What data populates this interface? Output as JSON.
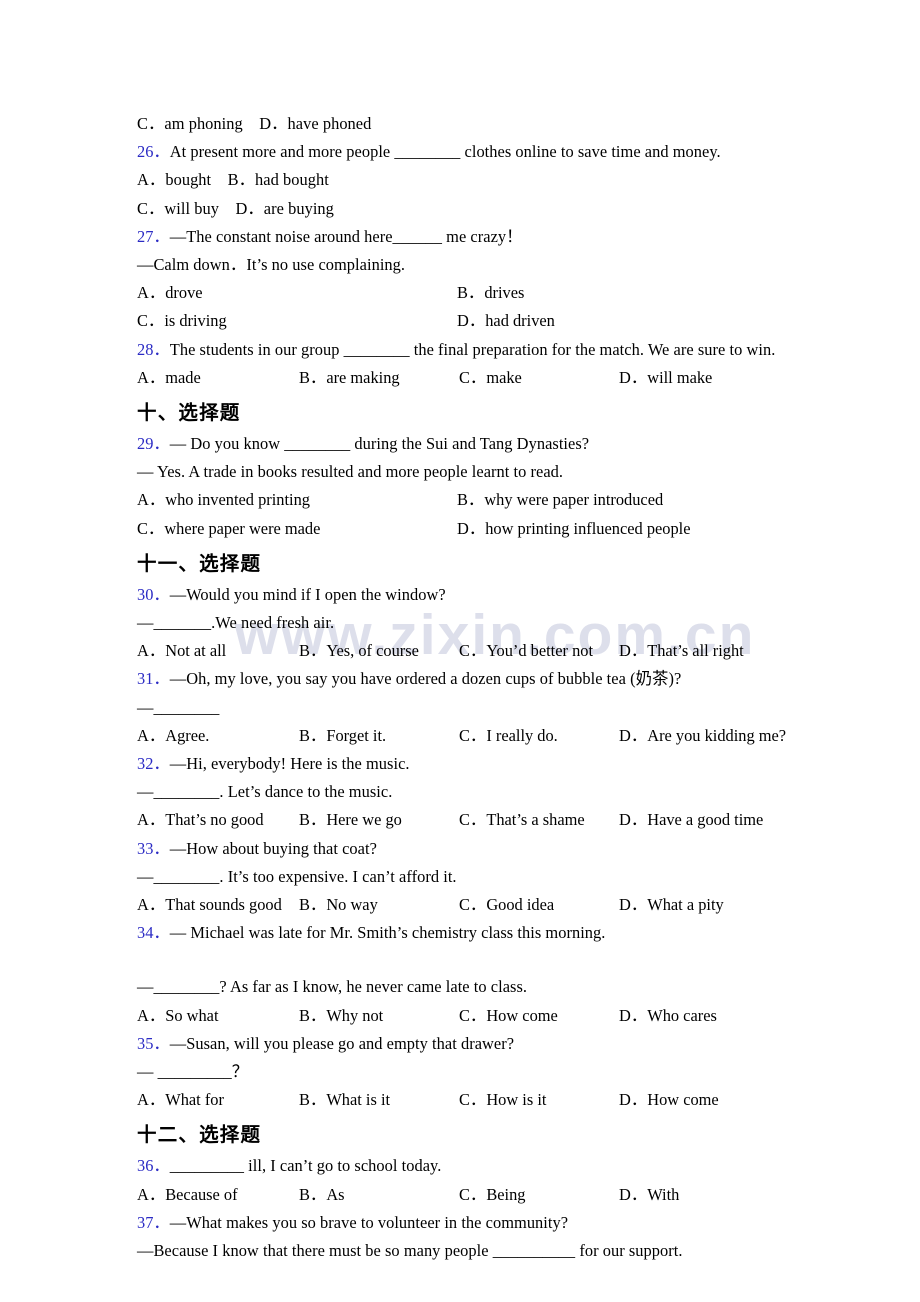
{
  "page": {
    "watermark": "www.zixin.com.cn",
    "number_color": "#2b2bc4",
    "text_color": "#000000",
    "background_color": "#ffffff"
  },
  "blocks": {
    "q25_tail": "C．am phoning D．have phoned",
    "q26_num": "26．",
    "q26_stem": "At present more and more people ________ clothes online to save time and money.",
    "q26_line1": "A．bought B．had bought",
    "q26_line2": "C．will buy D．are buying",
    "q27_num": "27．",
    "q27_stem": "—The constant noise around here______ me crazy！",
    "q27_reply": "—Calm down．It’s no use complaining.",
    "q27_a": "A．drove",
    "q27_b": "B．drives",
    "q27_c": "C．is driving",
    "q27_d": "D．had driven",
    "q28_num": "28．",
    "q28_stem": "The students in our group ________ the final preparation for the match. We are sure to win.",
    "q28_a": "A．made",
    "q28_b": "B．are making",
    "q28_c": "C．make",
    "q28_d": "D．will make",
    "head10": "十、选择题",
    "q29_num": "29．",
    "q29_stem": "— Do you know ________ during the Sui and Tang Dynasties?",
    "q29_reply": "— Yes. A trade in books resulted and more people learnt to read.",
    "q29_a": "A．who invented printing",
    "q29_b": "B．why were paper introduced",
    "q29_c": "C．where paper were made",
    "q29_d": "D．how printing influenced people",
    "head11": "十一、选择题",
    "q30_num": "30．",
    "q30_stem": "—Would you mind if I open the window?",
    "q30_reply": "—_______.We need fresh air.",
    "q30_a": "A．Not at all",
    "q30_b": "B．Yes, of course",
    "q30_c": "C．You’d better not",
    "q30_d": "D．That’s all right",
    "q31_num": "31．",
    "q31_stem": "—Oh, my love, you say you have ordered a dozen cups of bubble tea (奶茶)?",
    "q31_reply": "—________",
    "q31_a": "A．Agree.",
    "q31_b": "B．Forget it.",
    "q31_c": "C．I really do.",
    "q31_d": "D．Are you kidding me?",
    "q32_num": "32．",
    "q32_stem": "—Hi, everybody! Here is the music.",
    "q32_reply": "—________. Let’s dance to the music.",
    "q32_a": "A．That’s no good",
    "q32_b": "B．Here we go",
    "q32_c": "C．That’s a shame",
    "q32_d": "D．Have a good time",
    "q33_num": "33．",
    "q33_stem": "—How about buying that coat?",
    "q33_reply": "—________. It’s too expensive. I can’t afford it.",
    "q33_a": "A．That sounds good",
    "q33_b": "B．No way",
    "q33_c": "C．Good idea",
    "q33_d": "D．What a pity",
    "q34_num": "34．",
    "q34_stem": "— Michael was late for Mr. Smith’s chemistry class this morning.",
    "q34_reply": "—________? As far as I know, he never came late to class.",
    "q34_a": "A．So what",
    "q34_b": "B．Why not",
    "q34_c": "C．How come",
    "q34_d": "D．Who cares",
    "q35_num": "35．",
    "q35_stem": "—Susan, will you please go and empty that drawer?",
    "q35_reply": "— _________？",
    "q35_a": "A．What for",
    "q35_b": "B．What is it",
    "q35_c": "C．How is it",
    "q35_d": "D．How come",
    "head12": "十二、选择题",
    "q36_num": "36．",
    "q36_stem": "_________ ill, I can’t go to school today.",
    "q36_a": "A．Because of",
    "q36_b": "B．As",
    "q36_c": "C．Being",
    "q36_d": "D．With",
    "q37_num": "37．",
    "q37_stem": "—What makes you so brave to volunteer in the community?",
    "q37_reply": "—Because I know that there must be so many people __________ for our support."
  }
}
